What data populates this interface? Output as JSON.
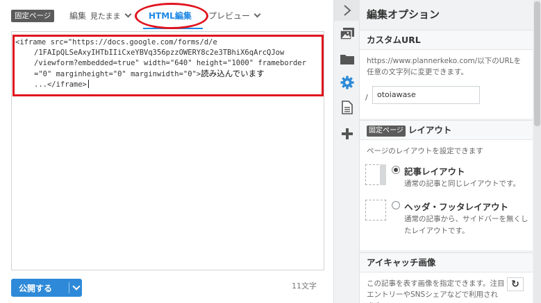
{
  "editor": {
    "page_badge": "固定ページ",
    "mode_edit": "編集",
    "mode_edit_sub": "見たまま",
    "mode_html": "HTML編集",
    "mode_preview": "プレビュー",
    "code_lines": [
      "<iframe src=\"https://docs.google.com/forms/d/e",
      "/1FAIpQLSeAxyIHTbIIiCxeYBVq356pzzOWERY8c2e3TBhiX6qArcQJow",
      "/viewform?embedded=true\" width=\"640\" height=\"1000\" frameborder",
      "=\"0\" marginheight=\"0\" marginwidth=\"0\">"
    ],
    "code_jp": "読み込んでいます",
    "code_end": "...</iframe>",
    "publish_label": "公開する",
    "char_count": "11文字"
  },
  "toolbar": {
    "icons": [
      "chevron-right-icon",
      "image-icon",
      "folder-icon",
      "gear-icon",
      "document-icon",
      "plus-icon"
    ]
  },
  "panel": {
    "title": "編集オプション",
    "custom_url": {
      "heading": "カスタムURL",
      "desc": "https://www.plannerkeko.com/以下のURLを任意の文字列に変更できます。",
      "slash": "/",
      "value": "otoiawase"
    },
    "layout": {
      "badge": "固定ページ",
      "heading": "レイアウト",
      "desc": "ページのレイアウトを設定できます",
      "options": [
        {
          "label": "記事レイアウト",
          "desc": "通常の記事と同じレイアウトです。",
          "selected": true
        },
        {
          "label": "ヘッダ・フッタレイアウト",
          "desc": "通常の記事から、サイドバーを無くしたレイアウトです。",
          "selected": false
        }
      ]
    },
    "eyecatch": {
      "heading": "アイキャッチ画像",
      "desc": "この記事を表す画像を指定できます。注目エントリーやSNSシェアなどで利用されます。"
    }
  },
  "colors": {
    "accent": "#2e8ad8",
    "annotation_red": "#e0141e",
    "badge_gray": "#5b5b5b"
  }
}
